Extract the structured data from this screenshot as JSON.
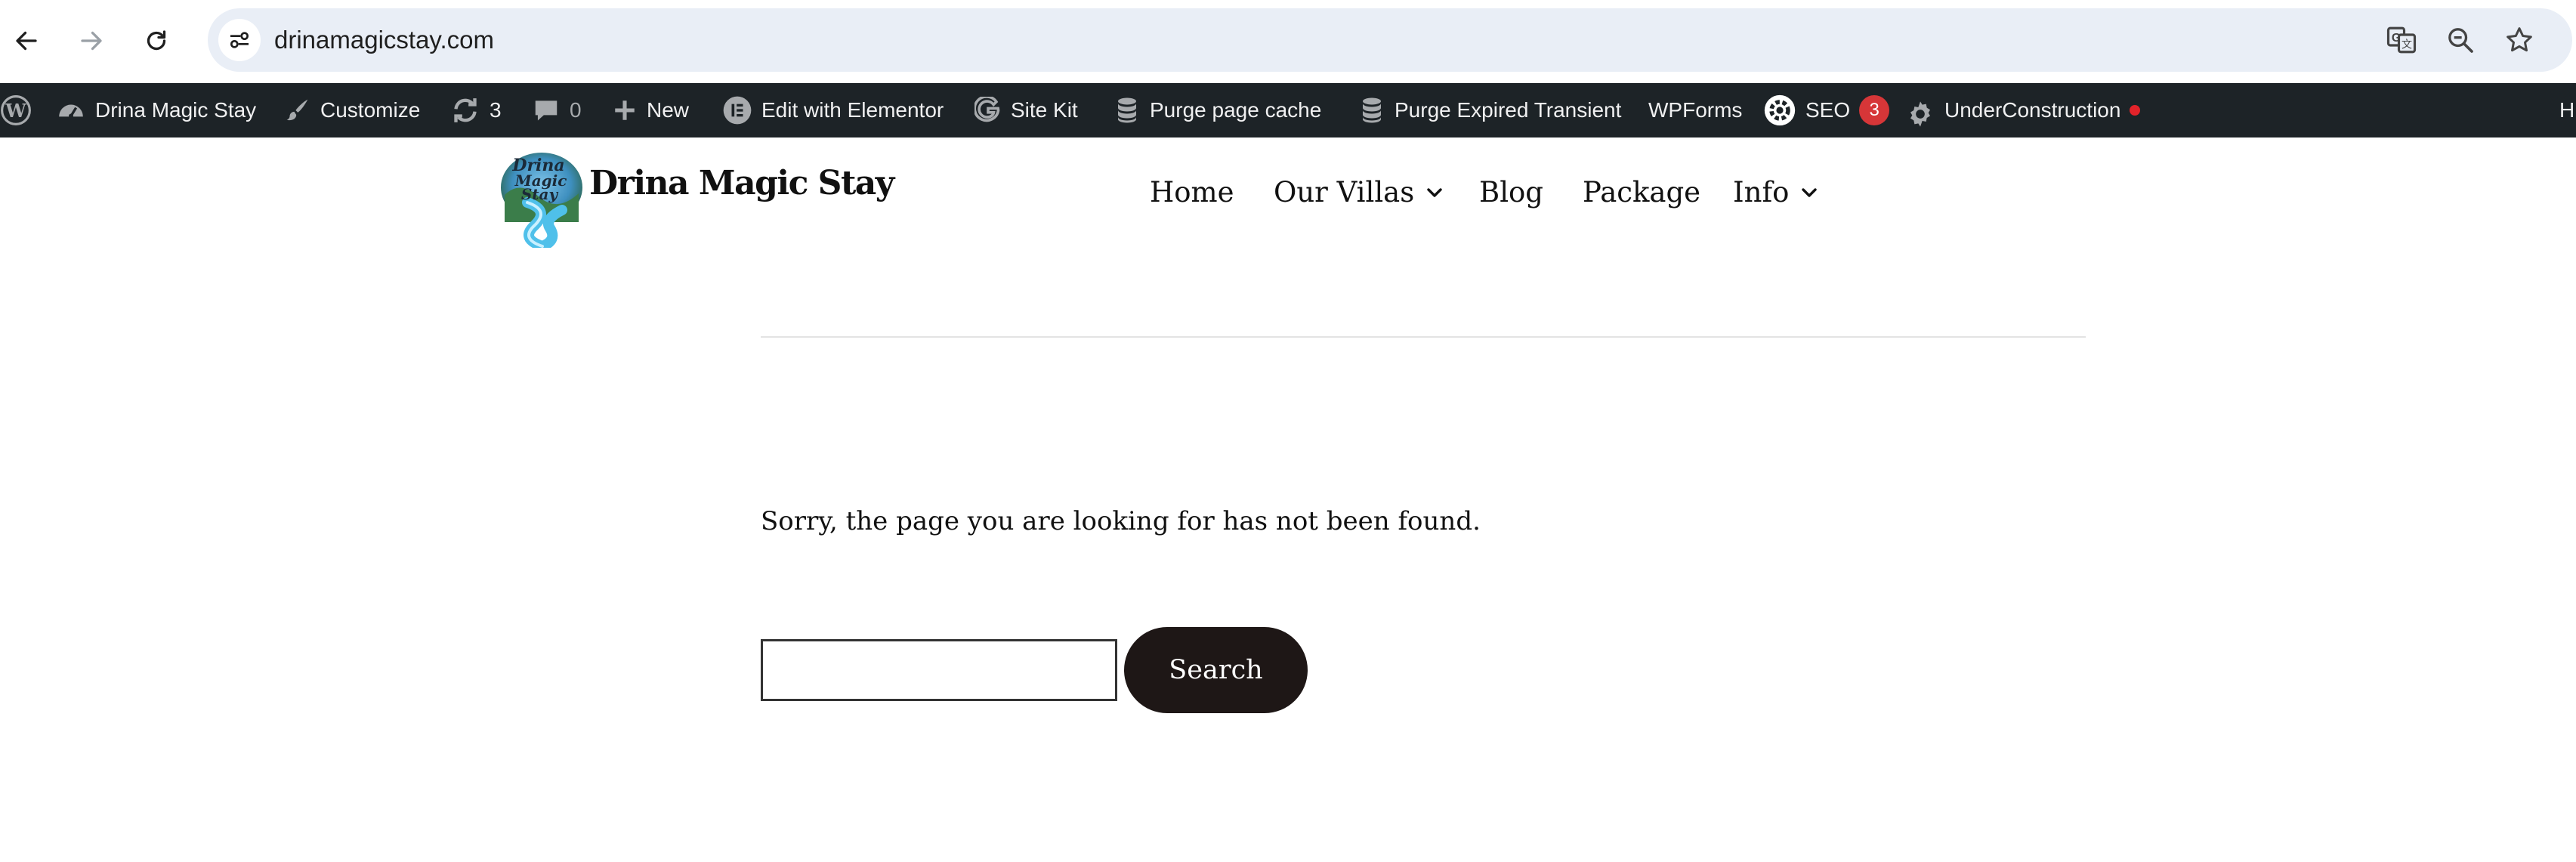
{
  "browser": {
    "url": "drinamagicstay.com",
    "icons": {
      "back": "back-arrow-icon",
      "forward": "forward-arrow-icon",
      "reload": "reload-icon",
      "site_info": "site-info-icon",
      "translate": "translate-icon",
      "zoom": "zoom-out-icon",
      "bookmark": "bookmark-star-icon"
    }
  },
  "admin_bar": {
    "site_name": "Drina Magic Stay",
    "customize": "Customize",
    "updates_count": "3",
    "comments_count": "0",
    "new": "New",
    "elementor": "Edit with Elementor",
    "site_kit": "Site Kit",
    "purge_cache": "Purge page cache",
    "purge_transient": "Purge Expired Transient",
    "wpforms": "WPForms",
    "seo": "SEO",
    "seo_badge": "3",
    "under_construction": "UnderConstruction",
    "edge_text": "H",
    "colors": {
      "background": "#1d2327",
      "text": "#f0f0f1",
      "badge": "#d63638",
      "status_dot": "#e2232a"
    }
  },
  "site": {
    "title": "Drina Magic Stay",
    "logo_text": [
      "Drina",
      "Magic",
      "Stay"
    ],
    "nav": [
      {
        "label": "Home"
      },
      {
        "label": "Our Villas"
      },
      {
        "label": "Blog"
      },
      {
        "label": "Package"
      },
      {
        "label": "Info"
      }
    ]
  },
  "content": {
    "message": "Sorry, the page you are looking for has not been found.",
    "search": {
      "value": "",
      "placeholder": "",
      "button_label": "Search",
      "button_color": "#1e1716"
    }
  }
}
